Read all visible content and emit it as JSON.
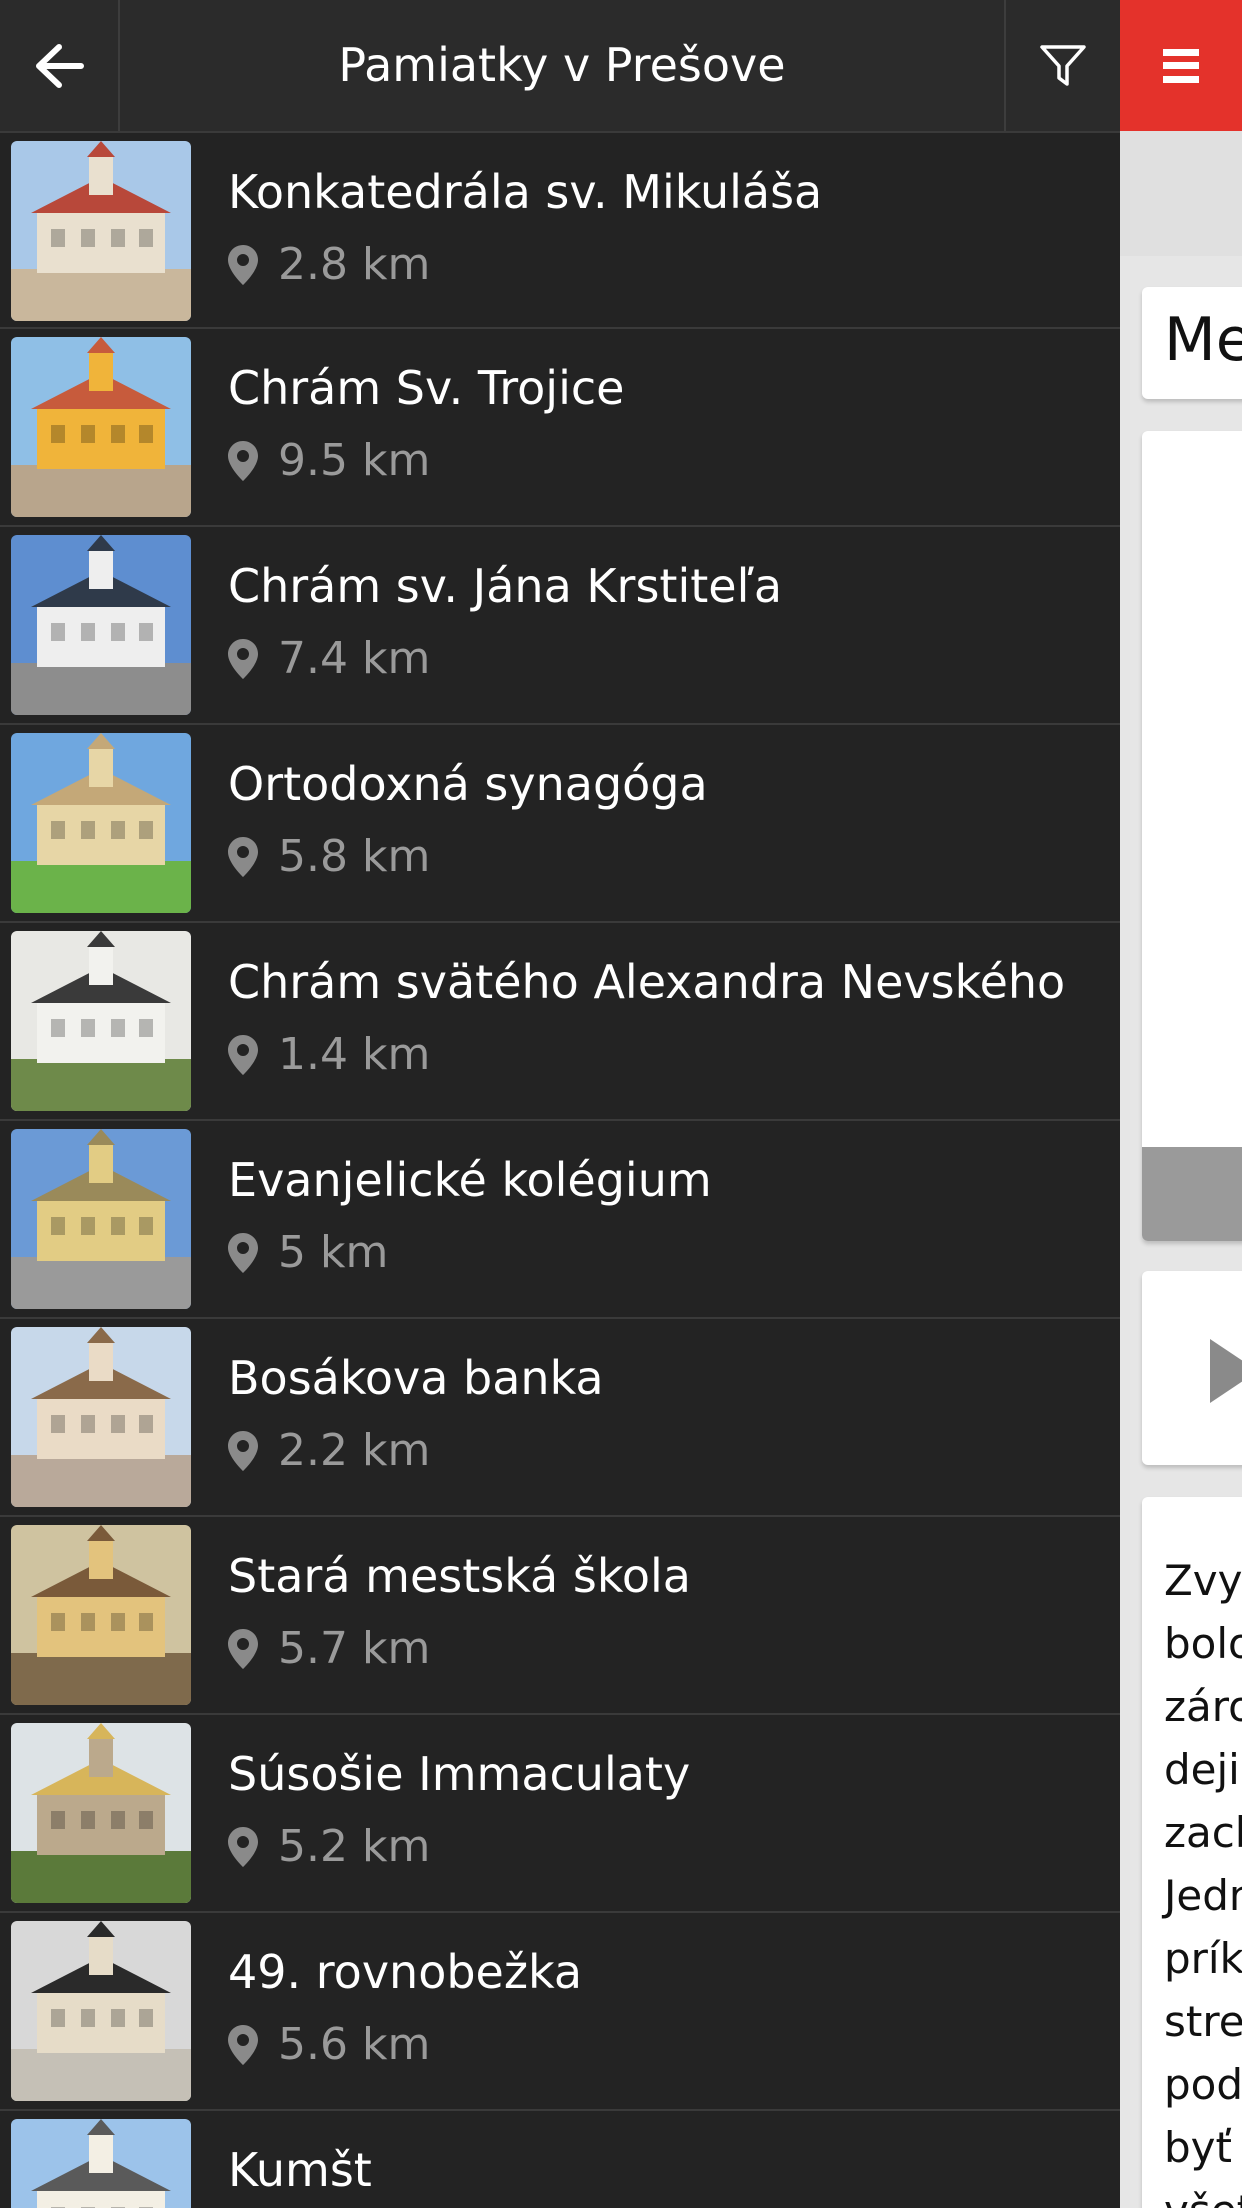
{
  "header": {
    "title": "Pamiatky v Prešove",
    "back_icon": "arrow-left-icon",
    "filter_icon": "filter-icon",
    "menu_icon": "hamburger-menu-icon",
    "accent_color": "#e4322b"
  },
  "sights": [
    {
      "name": "Konkatedrála sv. Mikuláša",
      "distance": "2.8 km",
      "thumb": {
        "sky": "#a9c8e8",
        "ground": "#c9b79c",
        "building": "#e9e0cf",
        "roof": "#b8483a"
      }
    },
    {
      "name": "Chrám Sv. Trojice",
      "distance": "9.5 km",
      "thumb": {
        "sky": "#8fbfe6",
        "ground": "#b8a58c",
        "building": "#f0b43a",
        "roof": "#c75b3c"
      }
    },
    {
      "name": "Chrám sv. Jána Krstiteľa",
      "distance": "7.4 km",
      "thumb": {
        "sky": "#5e8ed0",
        "ground": "#8d8d8d",
        "building": "#eeeeee",
        "roof": "#2f3a4a"
      }
    },
    {
      "name": "Ortodoxná synagóga",
      "distance": "5.8 km",
      "thumb": {
        "sky": "#6fa7df",
        "ground": "#6bb34a",
        "building": "#e7d6a6",
        "roof": "#c4a878"
      }
    },
    {
      "name": "Chrám svätého Alexandra Nevského",
      "distance": "1.4 km",
      "thumb": {
        "sky": "#e8e8e4",
        "ground": "#6e8a4a",
        "building": "#f2f2ee",
        "roof": "#3a3a3a"
      }
    },
    {
      "name": "Evanjelické kolégium",
      "distance": "5 km",
      "thumb": {
        "sky": "#6b9ad6",
        "ground": "#9a9a9a",
        "building": "#e2cc84",
        "roof": "#9a8a5a"
      }
    },
    {
      "name": "Bosákova banka",
      "distance": "2.2 km",
      "thumb": {
        "sky": "#c7d8ea",
        "ground": "#b9a99a",
        "building": "#eadbc6",
        "roof": "#8a6a4a"
      }
    },
    {
      "name": "Stará mestská škola",
      "distance": "5.7 km",
      "thumb": {
        "sky": "#cfc3a0",
        "ground": "#7f6a4c",
        "building": "#e3c37d",
        "roof": "#7a5a3a"
      }
    },
    {
      "name": "Súsošie Immaculaty",
      "distance": "5.2 km",
      "thumb": {
        "sky": "#dde3e6",
        "ground": "#5b7a3a",
        "building": "#bba98c",
        "roof": "#d7b55a"
      }
    },
    {
      "name": "49. rovnobežka",
      "distance": "5.6 km",
      "thumb": {
        "sky": "#d8d8d8",
        "ground": "#c5c0b6",
        "building": "#e6dcc8",
        "roof": "#2a2a2a"
      }
    },
    {
      "name": "Kumšt",
      "distance": "",
      "thumb": {
        "sky": "#9cc3ea",
        "ground": "#6aa13e",
        "building": "#f3efe4",
        "roof": "#5a5a5a"
      }
    }
  ],
  "background_panel": {
    "card_title_visible": "Me",
    "text_visible": [
      "Zvyš",
      "bolo",
      "záro",
      "dejin",
      "zach",
      "Jedn",
      "prík",
      "stre",
      "pod",
      "byť",
      "všet"
    ]
  }
}
